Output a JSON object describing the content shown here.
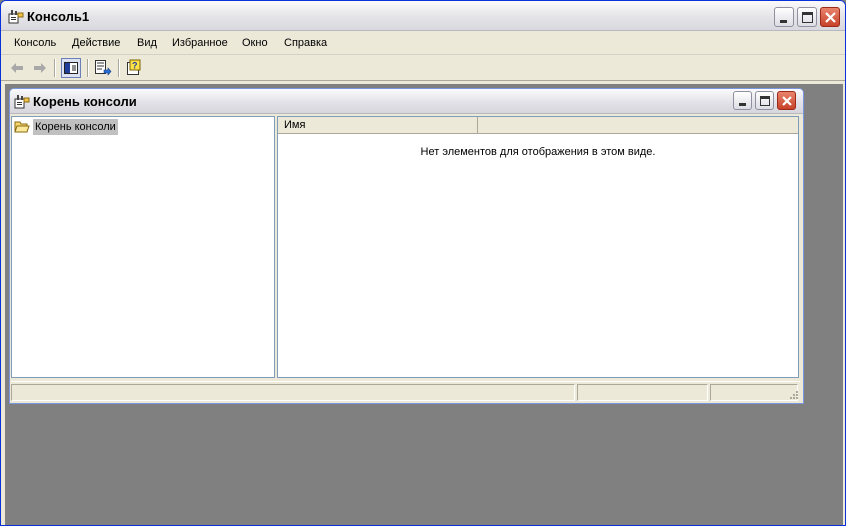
{
  "outer_window": {
    "title": "Консоль1",
    "icon": "mmc-console-icon"
  },
  "menu": {
    "items": [
      "Консоль",
      "Действие",
      "Вид",
      "Избранное",
      "Окно",
      "Справка"
    ]
  },
  "toolbar": {
    "buttons": [
      "back-arrow-icon",
      "forward-arrow-icon",
      "show-hide-tree-icon",
      "export-list-icon",
      "help-icon"
    ]
  },
  "child_window": {
    "title": "Корень консоли",
    "icon": "mmc-console-icon"
  },
  "tree": {
    "root_label": "Корень консоли",
    "root_icon": "folder-open-icon"
  },
  "list": {
    "columns": [
      "Имя",
      ""
    ],
    "empty_message": "Нет элементов для отображения в этом виде."
  },
  "colors": {
    "mdi_background": "#808080",
    "window_face": "#ECE9D8",
    "close_button": "#C7422A",
    "selection": "#C0C0C0"
  }
}
